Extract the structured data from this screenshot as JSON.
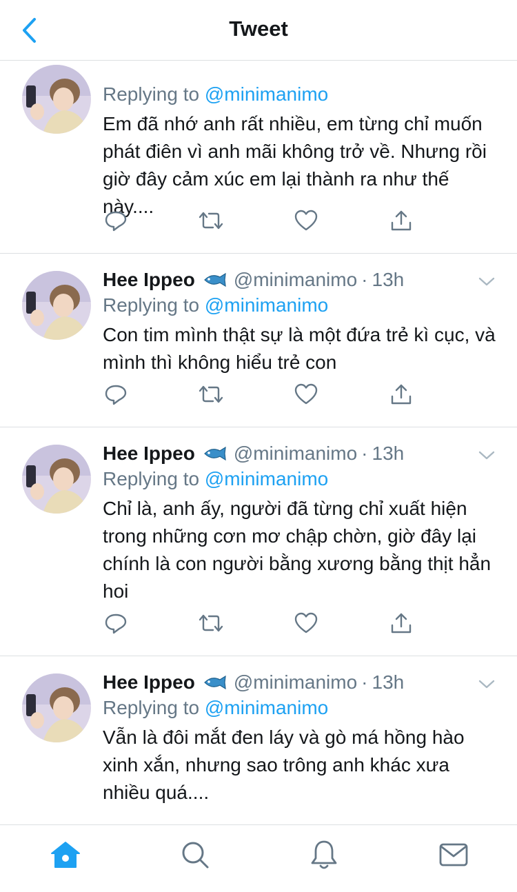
{
  "nav": {
    "title": "Tweet",
    "back_icon": "chevron-left-icon",
    "accent": "#1da1f2"
  },
  "tweets": [
    {
      "name": "",
      "handle": "",
      "dot": "",
      "time": "",
      "replying_prefix": "Replying to",
      "replying_handle": "@minimanimo",
      "text": "Em đã nhớ anh rất nhiều, em từng chỉ muốn phát điên vì anh mãi không trở về. Nhưng rồi giờ đây cảm xúc em lại thành ra như thế này...."
    },
    {
      "name": "Hee Ippeo",
      "handle": "@minimanimo",
      "dot": "·",
      "time": "13h",
      "replying_prefix": "Replying to",
      "replying_handle": "@minimanimo",
      "text": "Con tim mình thật sự là một đứa trẻ kì cục, và mình thì không hiểu trẻ con"
    },
    {
      "name": "Hee Ippeo",
      "handle": "@minimanimo",
      "dot": "·",
      "time": "13h",
      "replying_prefix": "Replying to",
      "replying_handle": "@minimanimo",
      "text": "Chỉ là, anh ấy, người đã từng chỉ xuất hiện trong những cơn mơ chập chờn, giờ đây lại chính là con người bằng xương bằng thịt hẳn hoi"
    },
    {
      "name": "Hee Ippeo",
      "handle": "@minimanimo",
      "dot": "·",
      "time": "13h",
      "replying_prefix": "Replying to",
      "replying_handle": "@minimanimo",
      "text": "Vẫn là đôi mắt đen láy và gò má hồng hào xinh xắn, nhưng sao trông anh khác xưa nhiều quá...."
    }
  ],
  "icons": {
    "emoji": "fish-icon",
    "more": "chevron-down-icon",
    "actions": [
      "reply-icon",
      "retweet-icon",
      "like-icon",
      "share-icon"
    ]
  },
  "tabbar": [
    "home-icon",
    "search-icon",
    "notifications-icon",
    "messages-icon"
  ],
  "colors": {
    "link": "#1da1f2",
    "secondary_text": "#657786",
    "primary_text": "#14171a",
    "divider": "#dcdfe2"
  }
}
